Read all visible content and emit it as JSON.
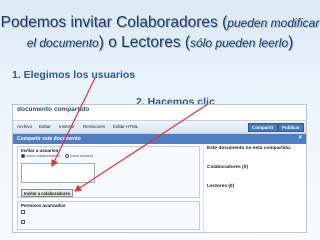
{
  "title": {
    "prefix": "Podemos invitar Colaboradores (",
    "paren1": "pueden modificar el documento",
    "middle": ") o Lectores (",
    "paren2": "sólo pueden leerlo",
    "suffix": ")"
  },
  "steps": {
    "step1": "1. Elegimos los usuarios",
    "step2": "2. Hacemos clic"
  },
  "colors": {
    "title": "#1f3a6e",
    "step": "#2d5a9a",
    "arrow": "#e0343a",
    "share_bar": "#4f7fc2"
  },
  "screenshot": {
    "doc_title": "documento compartido",
    "toolbar": {
      "items": [
        "Archivo",
        "Editar",
        "Insertar",
        "Revisiones",
        "Editar HTML"
      ],
      "buttons": [
        "Compartir",
        "Publicar"
      ]
    },
    "share_bar": {
      "label": "Compartir este documento",
      "close_icon": "close-icon"
    },
    "invite": {
      "title": "Invitar a usuarios:",
      "radio_collab": "como colaboradores",
      "radio_readers": "como lectores",
      "invite_button": "Invitar a colaboradores"
    },
    "advanced": {
      "title": "Permisos avanzados"
    },
    "right_pane": {
      "title": "Este documento no está compartido.",
      "collab_title": "Colaboradores (0)",
      "readers_title": "Lectores (0)"
    }
  }
}
